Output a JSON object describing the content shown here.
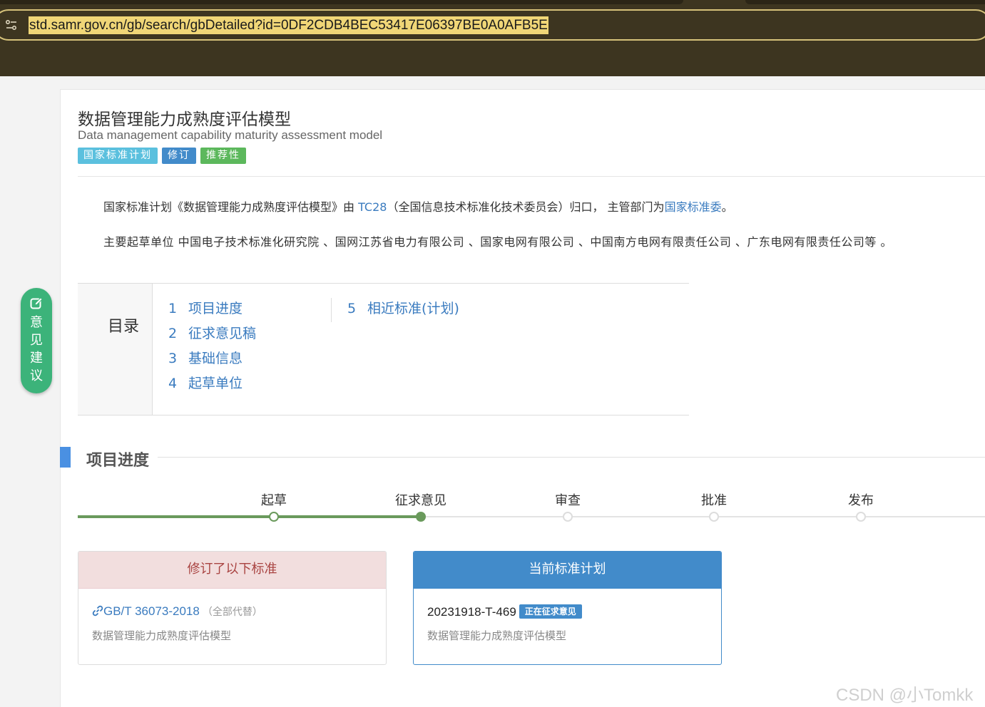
{
  "browser": {
    "url": "std.samr.gov.cn/gb/search/gbDetailed?id=0DF2CDB4BEC53417E06397BE0A0AFB5E"
  },
  "header": {
    "title_cn": "数据管理能力成熟度评估模型",
    "title_en": "Data management capability maturity assessment model",
    "badges": [
      "国家标准计划",
      "修订",
      "推荐性"
    ]
  },
  "description": {
    "line1_prefix": "国家标准计划《数据管理能力成熟度评估模型》由 ",
    "tc_link": "TC28",
    "line1_middle": "（全国信息技术标准化技术委员会）归口， 主管部门为",
    "dept_link": "国家标准委",
    "line1_suffix": "。",
    "line2": "主要起草单位 中国电子技术标准化研究院 、国网江苏省电力有限公司 、国家电网有限公司 、中国南方电网有限责任公司 、广东电网有限责任公司等 。"
  },
  "toc": {
    "label": "目录",
    "items": [
      {
        "num": "1",
        "label": "项目进度"
      },
      {
        "num": "2",
        "label": "征求意见稿"
      },
      {
        "num": "3",
        "label": "基础信息"
      },
      {
        "num": "4",
        "label": "起草单位"
      },
      {
        "num": "5",
        "label": "相近标准(计划)"
      }
    ]
  },
  "feedback": {
    "label": "意见建议"
  },
  "progress": {
    "section_title": "项目进度",
    "steps": [
      "起草",
      "征求意见",
      "审查",
      "批准",
      "发布"
    ],
    "current_step": 2
  },
  "panels": {
    "revised": {
      "title": "修订了以下标准",
      "std_no": "GB/T 36073-2018",
      "std_note": "（全部代替）",
      "std_name": "数据管理能力成熟度评估模型"
    },
    "current_plan": {
      "title": "当前标准计划",
      "plan_no": "20231918-T-469",
      "status": "正在征求意见",
      "plan_name": "数据管理能力成熟度评估模型"
    }
  },
  "watermark": "CSDN @小Tomkk"
}
